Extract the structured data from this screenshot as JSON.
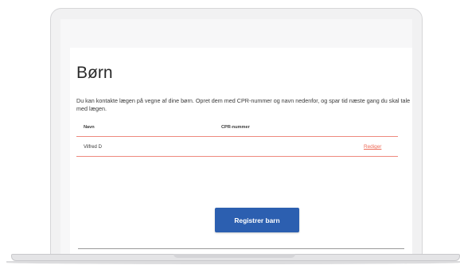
{
  "page": {
    "title": "Børn",
    "intro": "Du kan kontakte lægen på vegne af dine børn. Opret dem med CPR-nummer og navn nedenfor, og spar tid næste gang du skal tale med lægen."
  },
  "table": {
    "headers": [
      "Navn",
      "CPR-nummer"
    ],
    "rows": [
      {
        "name": "Vilfred D",
        "cpr": "",
        "action": "Rediger"
      }
    ]
  },
  "actions": {
    "register_label": "Registrer barn"
  },
  "colors": {
    "primary_button": "#2c5fb0",
    "accent_link": "#ee6b58",
    "divider": "#ee8a7f"
  }
}
